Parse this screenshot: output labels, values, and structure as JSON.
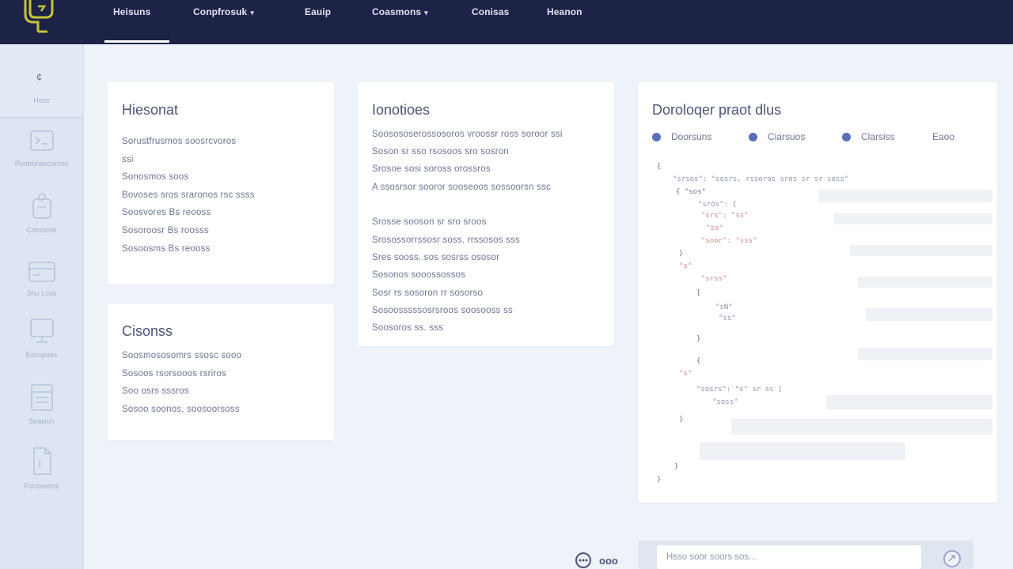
{
  "nav": {
    "items": [
      {
        "label": "Heisuns",
        "has_caret": false
      },
      {
        "label": "Conpfrosuk",
        "has_caret": true
      },
      {
        "label": "Eauip",
        "has_caret": false
      },
      {
        "label": "Coasmons",
        "has_caret": true
      },
      {
        "label": "Conisas",
        "has_caret": false
      },
      {
        "label": "Heanon",
        "has_caret": false
      }
    ],
    "caret_glyph": "▾"
  },
  "rail": {
    "top_label": "Hoss",
    "top_icon_glyph": "¢",
    "items": [
      {
        "label": "Pontronsecomsn",
        "icon": "terminal-icon"
      },
      {
        "label": "Comsonk",
        "icon": "puzzle-icon"
      },
      {
        "label": "Shu Lcus",
        "icon": "card-icon"
      },
      {
        "label": "Escopoes",
        "icon": "monitor-icon"
      },
      {
        "label": "Seasion",
        "icon": "document-icon"
      },
      {
        "label": "Fonsseons",
        "icon": "file-icon"
      }
    ]
  },
  "cards": {
    "hiesonat": {
      "title": "Hiesonat",
      "lines": [
        "Sorustfrusmos soosrcvoros",
        "ssi",
        "Sonosmos soos",
        "Bovoses sros sraronos rsc ssss",
        "Soosvores Bs reooss",
        "Sosoroosr Bs roosss",
        "Sosoosms Bs reooss"
      ]
    },
    "cisonss": {
      "title": "Cisonss",
      "lines": [
        "Soosmososomrs ssosc sooo",
        "Sosoos rsorsooos rsriros",
        "Soo osrs sssros",
        "Sosoo soonos, soosoorsoss"
      ]
    },
    "ionotioes": {
      "title": "Ionotioes",
      "lines": [
        "Soosososerossosoros vroossr ross soroor ssi",
        "Soson sr sso rsosoos sro sosron",
        "Srosoe sosi soross orossros",
        "A ssosrsor sooror sooseoos sossoorsn ssc",
        "Srosse sooson sr sro sroos",
        "Srosossorrssosr soss. rrssosos sss",
        "Sres sooss. sos sosrss ososor",
        "Sosonos sooossossos",
        "Sosr rs sosoron rr sosorso",
        "Sosoosssssosrsroos soosooss ss",
        "Soosoros ss. sss"
      ]
    },
    "developer": {
      "title": "Doroloqer praot dlus",
      "tabs": [
        {
          "label": "Doorsuns"
        },
        {
          "label": "Ciarsuos"
        },
        {
          "label": "Clarsiss"
        },
        {
          "label": "Eaoo"
        }
      ],
      "code_lines": [
        {
          "text": "{",
          "kind": "brace"
        },
        {
          "text": "\"srsos\": \"sosrs, rssoros sros sr sr soss\"",
          "kind": "code"
        },
        {
          "text": "{ \"sos\"",
          "kind": "brace"
        },
        {
          "text": "\"sros\": {",
          "kind": "code"
        },
        {
          "text": "\"srs\": \"ss\"",
          "kind": "red"
        },
        {
          "text": "\"ss\"",
          "kind": "red"
        },
        {
          "text": "\"soor\": \"sss\"",
          "kind": "red"
        },
        {
          "text": "}",
          "kind": "brace"
        },
        {
          "text": "\"s\"",
          "kind": "red"
        },
        {
          "text": "\"srss\"",
          "kind": "red"
        },
        {
          "text": "[",
          "kind": "brace"
        },
        {
          "text": "\"sN\"",
          "kind": "code"
        },
        {
          "text": "\"ss\"",
          "kind": "code"
        },
        {
          "text": "}",
          "kind": "brace"
        },
        {
          "text": "{",
          "kind": "brace"
        },
        {
          "text": "\"s\"",
          "kind": "red"
        },
        {
          "text": "\"sosrs\": \"s\" sr ss [",
          "kind": "code"
        },
        {
          "text": "\"soss\"",
          "kind": "code"
        },
        {
          "text": "}",
          "kind": "brace"
        },
        {
          "text": "}",
          "kind": "brace"
        },
        {
          "text": "}",
          "kind": "brace"
        }
      ]
    }
  },
  "bottom": {
    "label": "ooo",
    "input": {
      "value": "",
      "placeholder": "Hsso soor soors sos..."
    }
  },
  "colors": {
    "topbar": "#1d2347",
    "accent": "#5a6fb8",
    "page_bg": "#eef2f9",
    "logo": "#c8c43a"
  }
}
